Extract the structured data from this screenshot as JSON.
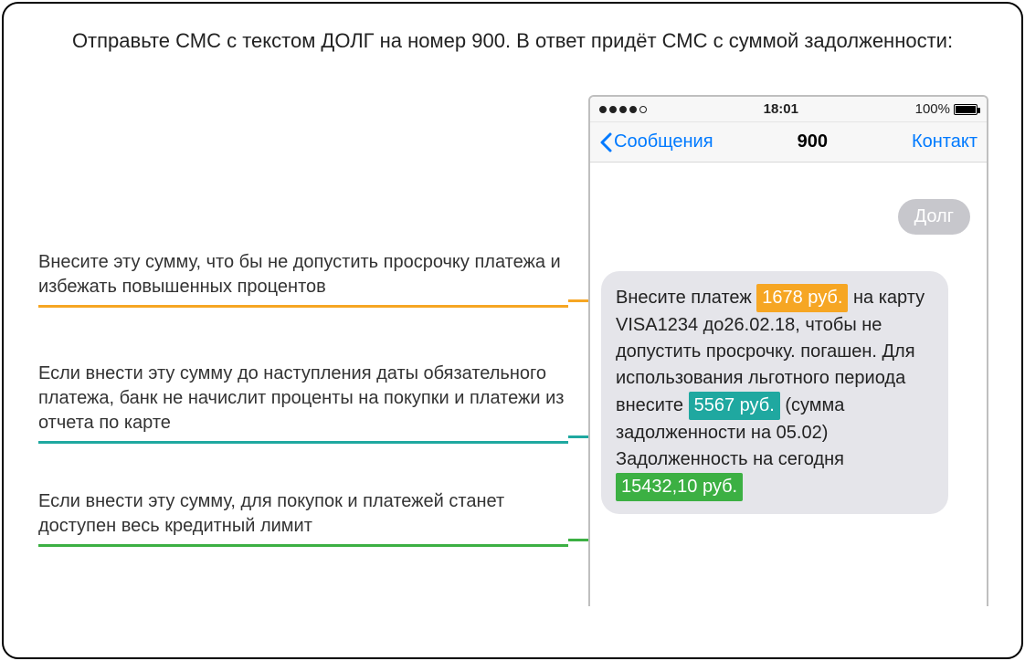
{
  "heading": "Отправьте СМС с текстом ДОЛГ на номер 900. В ответ придёт СМС с суммой задолженности:",
  "annotations": {
    "a1": "Внесите эту сумму, что бы не допустить просрочку платежа и избежать повышенных процентов",
    "a2": "Если внести эту сумму до наступления даты обязательного платежа, банк не начислит проценты на покупки и платежи из отчета по карте",
    "a3": "Если внести эту сумму, для покупок и платежей станет доступен весь кредитный лимит"
  },
  "phone": {
    "status": {
      "time": "18:01",
      "battery": "100%"
    },
    "nav": {
      "back": "Сообщения",
      "title": "900",
      "contact": "Контакт"
    },
    "outgoing": "Долг",
    "sms": {
      "p1a": "Внесите платеж ",
      "amount1": "1678 руб.",
      "p1b": " на карту VISA1234 до26.02.18, чтобы не допустить просрочку. погашен. Для использования льготного периода внесите ",
      "amount2": "5567 руб.",
      "p1c": " (сумма задолженности на 05.02) Задолженность на сегодня ",
      "amount3": "15432,10 руб."
    }
  }
}
